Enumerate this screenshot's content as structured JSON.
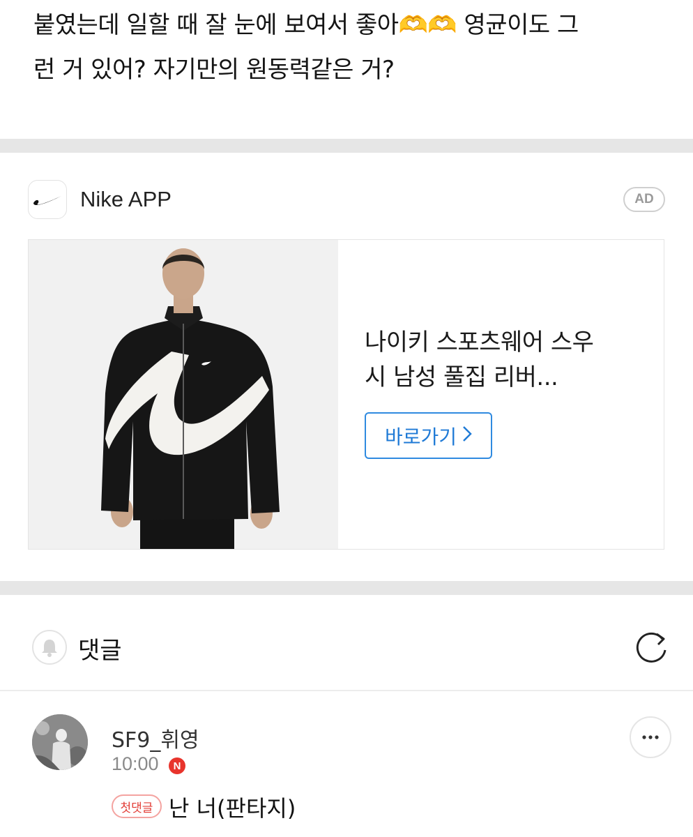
{
  "post": {
    "body_line1": "붙였는데 일할 때 잘 눈에 보여서 좋아🫶🫶 영균이도 그",
    "body_line2": "런 거 있어? 자기만의 원동력같은 거?"
  },
  "ad": {
    "brand_name": "Nike APP",
    "badge": "AD",
    "product_title_line1": "나이키 스포츠웨어 스우",
    "product_title_line2": "시 남성 풀집 리버...",
    "cta_label": "바로가기",
    "cta_chevron": "›",
    "brand_icon": "swoosh-logo",
    "accent_color": "#2f8ae0"
  },
  "comments": {
    "title": "댓글",
    "bell_icon": "bell-icon",
    "refresh_icon": "refresh-icon",
    "items": [
      {
        "username": "SF9_휘영",
        "time": "10:00",
        "new_badge": "N",
        "first_comment_badge": "첫댓글",
        "text": "난 너(판타지)",
        "more_icon": "more-icon"
      }
    ]
  }
}
